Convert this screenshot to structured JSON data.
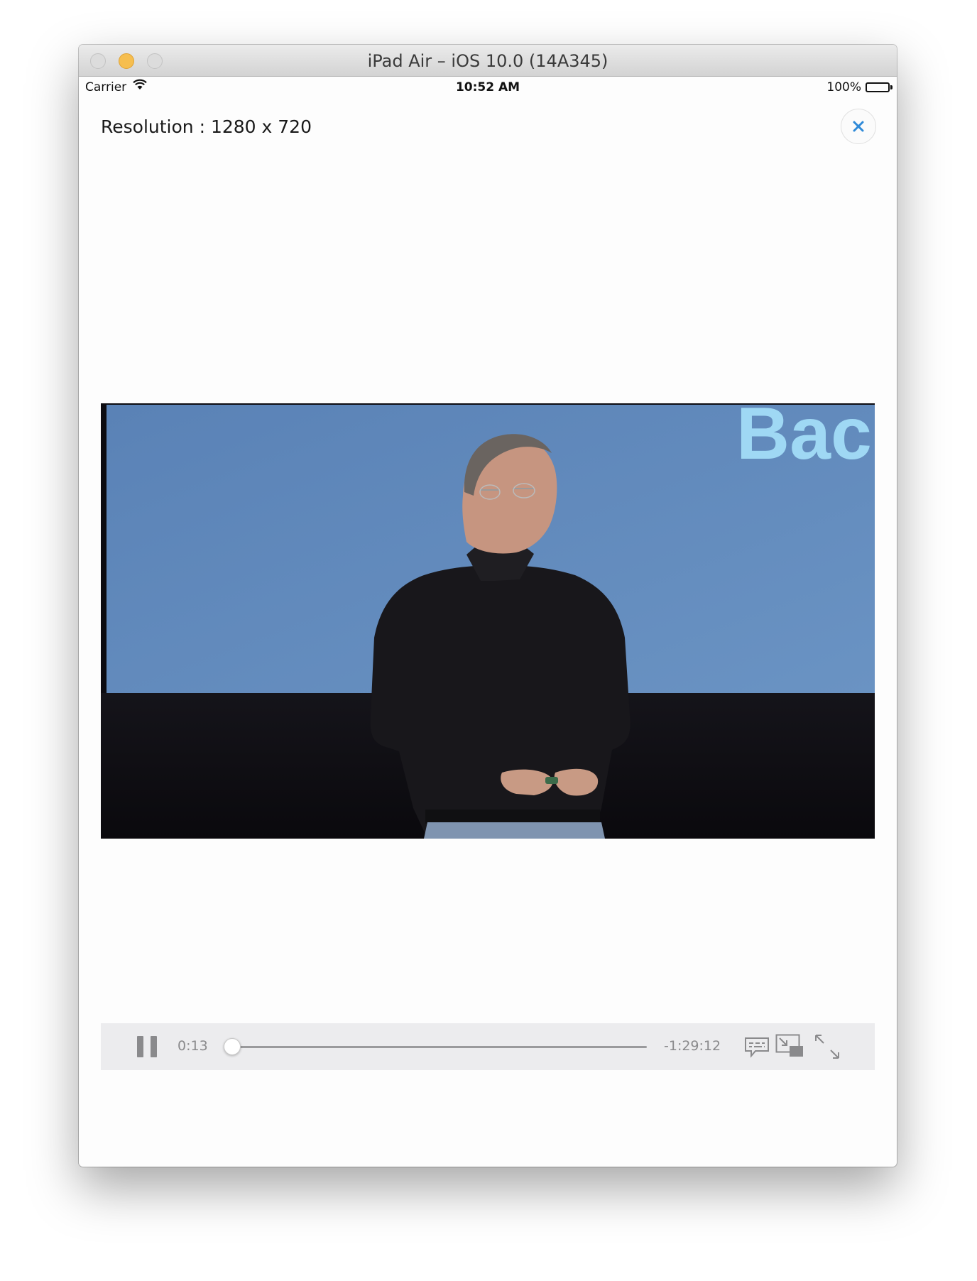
{
  "window": {
    "title": "iPad Air – iOS 10.0 (14A345)"
  },
  "status_bar": {
    "carrier": "Carrier",
    "time": "10:52 AM",
    "battery": "100%",
    "battery_level": 1.0
  },
  "header": {
    "resolution": "Resolution : 1280 x 720",
    "close_icon": "close-icon"
  },
  "video": {
    "slide_text": "Back",
    "colors": {
      "slide_background": "#5b84b8",
      "slide_text": "#9fd8f4",
      "stage": "#0c0b10"
    }
  },
  "player_controls": {
    "elapsed": "0:13",
    "remaining": "-1:29:12",
    "progress": 0.0024,
    "icons": [
      "pause-icon",
      "subtitles-icon",
      "picture-in-picture-icon",
      "fullscreen-icon"
    ]
  },
  "colors": {
    "accent": "#2f8ad8",
    "control_bar": "#ececee",
    "control_glyph": "#8a8a8c",
    "minimize_button": "#f6be4f"
  }
}
